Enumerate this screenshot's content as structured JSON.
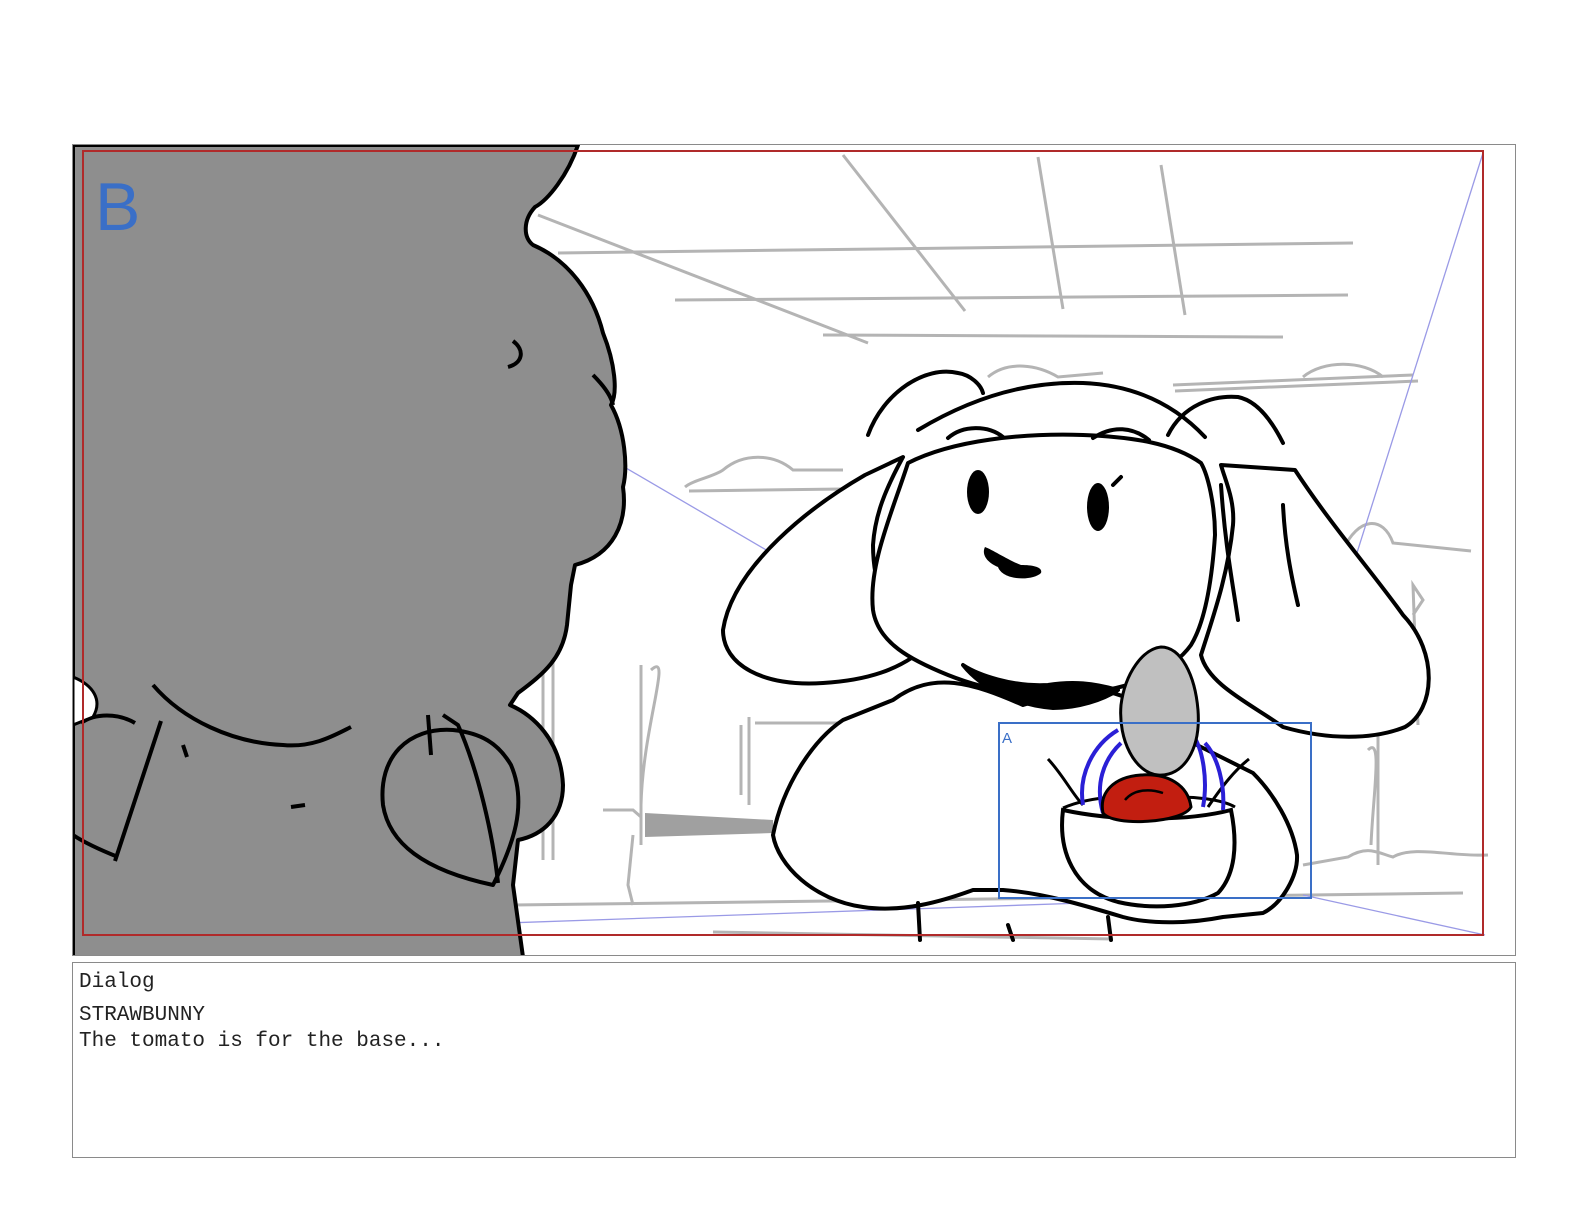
{
  "panel": {
    "label": "B",
    "camera_frame_color": "#b02a2a",
    "guide_color": "#3a6fc7",
    "subframe_label": "A"
  },
  "dialog": {
    "heading": "Dialog",
    "speaker": "STRAWBUNNY",
    "line": "The tomato is for the base..."
  },
  "colors": {
    "silhouette": "#8e8e8e",
    "background_sketch": "#b4b4b4",
    "tomato": "#c21e10",
    "egg": "#c0c0c0",
    "stems": "#2a1fd6"
  }
}
